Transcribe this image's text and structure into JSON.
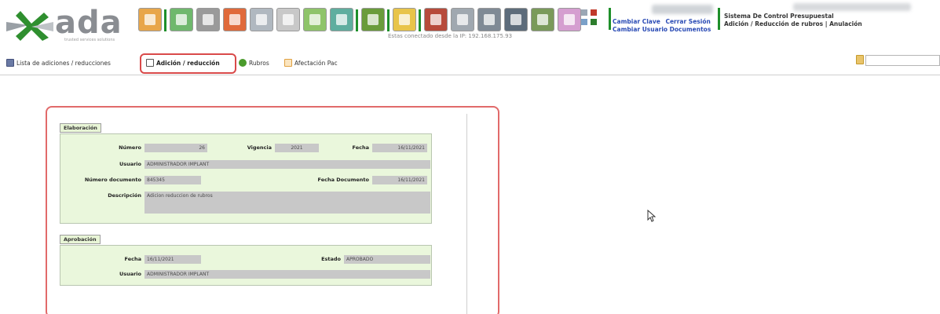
{
  "header": {
    "logo_text": "ada",
    "logo_tagline": "trusted services solutions",
    "ip_text": "Estas conectado desde la IP: 192.168.175.93",
    "links": {
      "change_password": "Cambiar Clave",
      "logout": "Cerrar Sesión",
      "change_user": "Cambiar Usuario Documentos"
    },
    "system_title": "Sistema De Control Presupuestal",
    "system_subtitle": "Adición / Reducción de rubros | Anulación",
    "toolbar_colors": [
      "#e8a64a",
      "#6fb86d",
      "#9a9a9a",
      "#e06a3b",
      "#b0b8c0",
      "#c8c8c8",
      "#8fc46a",
      "#5fae9f",
      "#6a9c3b",
      "#e8c44a",
      "#b74b3b",
      "#a0a8b0",
      "#7f8a95",
      "#5d6c7b",
      "#7a9a5a",
      "#d59ed0"
    ]
  },
  "tabs": [
    {
      "label": "Lista de adiciones / reducciones",
      "icon": "list-icon",
      "color": "#6a7aa5",
      "active": false
    },
    {
      "label": "Adición / reducción",
      "icon": "document-icon",
      "color": "#ffffff",
      "active": true
    },
    {
      "label": "Rubros",
      "icon": "leaf-icon",
      "color": "#4a9b2c",
      "active": false
    },
    {
      "label": "Afectación Pac",
      "icon": "chart-icon",
      "color": "#e0a040",
      "active": false
    }
  ],
  "search": {
    "value": ""
  },
  "elaboracion": {
    "title": "Elaboración",
    "numero_label": "Número",
    "numero_value": "26",
    "vigencia_label": "Vigencia",
    "vigencia_value": "2021",
    "fecha_label": "Fecha",
    "fecha_value": "16/11/2021",
    "usuario_label": "Usuario",
    "usuario_value": "ADMINISTRADOR IMPLANT",
    "numdoc_label": "Número documento",
    "numdoc_value": "845345",
    "fechadoc_label": "Fecha Documento",
    "fechadoc_value": "16/11/2021",
    "descripcion_label": "Descripción",
    "descripcion_value": "Adicion reduccion de rubros"
  },
  "aprobacion": {
    "title": "Aprobación",
    "fecha_label": "Fecha",
    "fecha_value": "16/11/2021",
    "estado_label": "Estado",
    "estado_value": "APROBADO",
    "usuario_label": "Usuario",
    "usuario_value": "ADMINISTRADOR IMPLANT"
  }
}
